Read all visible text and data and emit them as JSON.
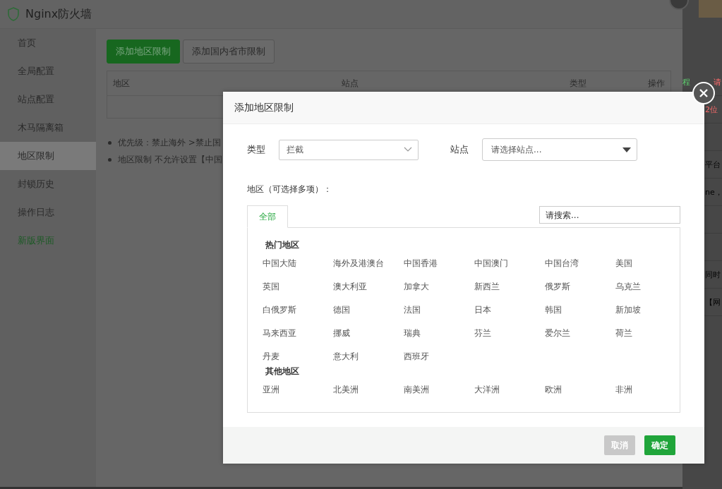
{
  "app": {
    "title": "Nginx防火墙"
  },
  "sidebar": {
    "items": [
      {
        "label": "首页",
        "selected": false,
        "kind": "normal"
      },
      {
        "label": "全局配置",
        "selected": false,
        "kind": "normal"
      },
      {
        "label": "站点配置",
        "selected": false,
        "kind": "normal"
      },
      {
        "label": "木马隔离箱",
        "selected": false,
        "kind": "normal"
      },
      {
        "label": "地区限制",
        "selected": true,
        "kind": "normal"
      },
      {
        "label": "封锁历史",
        "selected": false,
        "kind": "normal"
      },
      {
        "label": "操作日志",
        "selected": false,
        "kind": "normal"
      },
      {
        "label": "新版界面",
        "selected": false,
        "kind": "new"
      }
    ]
  },
  "toolbar": {
    "buttons": [
      {
        "label": "添加地区限制",
        "primary": true
      },
      {
        "label": "添加国内省市限制",
        "primary": false
      }
    ]
  },
  "table": {
    "columns": [
      "地区",
      "站点",
      "类型",
      "操作"
    ]
  },
  "notes": [
    "优先级：禁止海外 >禁止国",
    "地区限制 不允许设置【中国"
  ],
  "background_page": {
    "rows": [
      {
        "segments": [
          {
            "text": "程",
            "kind": "link"
          },
          {
            "text": "请",
            "kind": "warning"
          }
        ]
      },
      {
        "segments": [
          {
            "text": "2位",
            "kind": "warning"
          }
        ]
      },
      {
        "segments": []
      },
      {
        "segments": [
          {
            "text": "平台",
            "kind": "plain"
          }
        ]
      },
      {
        "segments": [
          {
            "text": "ne，",
            "kind": "plain"
          }
        ]
      },
      {
        "segments": []
      },
      {
        "segments": []
      },
      {
        "segments": [
          {
            "text": "同时",
            "kind": "plain"
          }
        ]
      },
      {
        "segments": [
          {
            "text": "【网",
            "kind": "plain"
          }
        ]
      }
    ]
  },
  "modal": {
    "title": "添加地区限制",
    "type_field": {
      "label": "类型",
      "value": "拦截"
    },
    "site_field": {
      "label": "站点",
      "placeholder": "请选择站点..."
    },
    "region_label": "地区（可选择多项）：",
    "tabs": [
      {
        "label": "全部",
        "selected": true
      }
    ],
    "search": {
      "placeholder": "请搜索..."
    },
    "groups": [
      {
        "title": "热门地区",
        "items": [
          "中国大陆",
          "海外及港澳台",
          "中国香港",
          "中国澳门",
          "中国台湾",
          "美国",
          "英国",
          "澳大利亚",
          "加拿大",
          "新西兰",
          "俄罗斯",
          "乌克兰",
          "白俄罗斯",
          "德国",
          "法国",
          "日本",
          "韩国",
          "新加坡",
          "马来西亚",
          "挪威",
          "瑞典",
          "芬兰",
          "爱尔兰",
          "荷兰",
          "丹麦",
          "意大利",
          "西班牙"
        ]
      },
      {
        "title": "其他地区",
        "items": [
          "亚洲",
          "北美洲",
          "南美洲",
          "大洋洲",
          "欧洲",
          "非洲"
        ]
      }
    ],
    "buttons": [
      {
        "label": "取消",
        "kind": "cancel"
      },
      {
        "label": "确定",
        "kind": "confirm"
      }
    ]
  }
}
